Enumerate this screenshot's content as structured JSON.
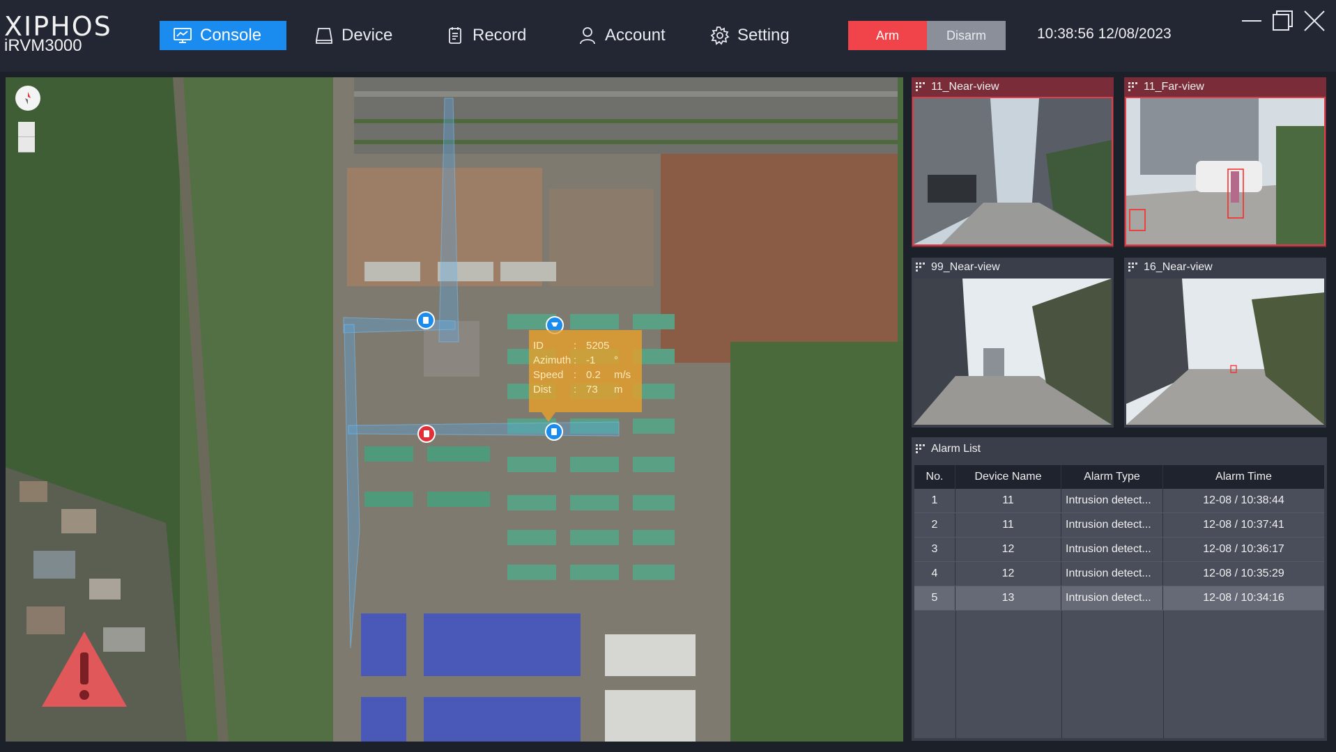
{
  "app": {
    "brand": "XIPHOS",
    "model": "iRVM3000"
  },
  "nav": [
    {
      "label": "Console",
      "icon": "monitor-icon",
      "active": true
    },
    {
      "label": "Device",
      "icon": "device-icon"
    },
    {
      "label": "Record",
      "icon": "record-icon"
    },
    {
      "label": "Account",
      "icon": "user-icon"
    },
    {
      "label": "Setting",
      "icon": "gear-icon"
    }
  ],
  "arm": {
    "arm_label": "Arm",
    "disarm_label": "Disarm",
    "active": "Arm"
  },
  "clock": "10:38:56 12/08/2023",
  "tooltip": {
    "id_label": "ID",
    "id_value": "5205",
    "id_unit": "",
    "azimuth_label": "Azimuth",
    "azimuth_value": "-1",
    "azimuth_unit": "°",
    "speed_label": "Speed",
    "speed_value": "0.2",
    "speed_unit": "m/s",
    "dist_label": "Dist",
    "dist_value": "73",
    "dist_unit": "m",
    "sep": ":"
  },
  "cameras": [
    {
      "name": "11_Near-view",
      "alert": true
    },
    {
      "name": "11_Far-view",
      "alert": true
    },
    {
      "name": "99_Near-view",
      "alert": false
    },
    {
      "name": "16_Near-view",
      "alert": false
    }
  ],
  "alarm_list": {
    "title": "Alarm List",
    "headers": [
      "No.",
      "Device Name",
      "Alarm Type",
      "Alarm Time"
    ],
    "rows": [
      [
        "1",
        "11",
        "Intrusion detect...",
        "12-08 / 10:38:44"
      ],
      [
        "2",
        "11",
        "Intrusion detect...",
        "12-08 / 10:37:41"
      ],
      [
        "3",
        "12",
        "Intrusion detect...",
        "12-08 / 10:36:17"
      ],
      [
        "4",
        "12",
        "Intrusion detect...",
        "12-08 / 10:35:29"
      ],
      [
        "5",
        "13",
        "Intrusion detect...",
        "12-08 / 10:34:16"
      ]
    ],
    "selected_row": 5
  },
  "colors": {
    "accent": "#1a8cf0",
    "arm": "#f0444a",
    "alert": "#7a2d38",
    "tooltip": "#eba028"
  }
}
